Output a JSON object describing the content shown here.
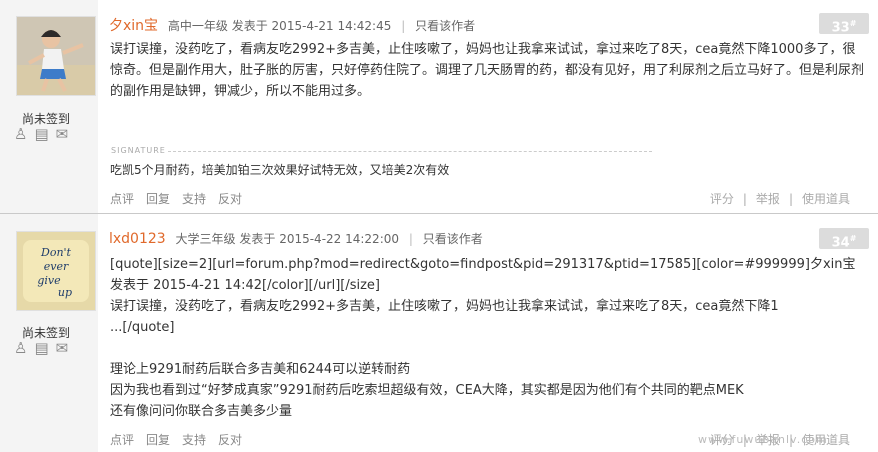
{
  "posts": [
    {
      "author": "夕xin宝",
      "grade": "高中一年级",
      "posted": "发表于 2015-4-21 14:42:45",
      "only_author": "只看该作者",
      "floor": "33",
      "checkin": "尚未签到",
      "body": "误打误撞，没药吃了，看病友吃2992+多吉美，止住咳嗽了，妈妈也让我拿来试试，拿过来吃了8天，cea竟然下降1000多了，很惊奇。但是副作用大，肚子胀的厉害，只好停药住院了。调理了几天肠胃的药，都没有见好，用了利尿剂之后立马好了。但是利尿剂的副作用是缺钾，钾减少，所以不能用过多。",
      "signature_label": "SIGNATURE",
      "signature": "吃凯5个月耐药，培美加铂三次效果好试特无效，又培美2次有效",
      "actions": [
        "点评",
        "回复",
        "支持",
        "反对"
      ],
      "actions_right": [
        "评分",
        "举报",
        "使用道具"
      ]
    },
    {
      "author": "lxd0123",
      "grade": "大学三年级",
      "posted": "发表于 2015-4-22 14:22:00",
      "only_author": "只看该作者",
      "floor": "34",
      "checkin": "尚未签到",
      "avatar_text": [
        "Don't",
        "ever",
        "give",
        "up"
      ],
      "quote": "[quote][size=2][url=forum.php?mod=redirect&goto=findpost&pid=291317&ptid=17585][color=#999999]夕xin宝 发表于 2015-4-21 14:42[/color][/url][/size]",
      "quote_body": "误打误撞，没药吃了，看病友吃2992+多吉美，止住咳嗽了，妈妈也让我拿来试试，拿过来吃了8天，cea竟然下降1",
      "quote_end": "...[/quote]",
      "lines": [
        "理论上9291耐药后联合多吉美和6244可以逆转耐药",
        "因为我也看到过“好梦成真家”9291耐药后吃索坦超级有效，CEA大降，其实都是因为他们有个共同的靶点MEK",
        "还有像问问你联合多吉美多少量"
      ],
      "actions": [
        "点评",
        "回复",
        "支持",
        "反对"
      ],
      "actions_right": [
        "评分",
        "举报",
        "使用道具"
      ]
    }
  ],
  "watermark": "www.fuwubanlv.com"
}
